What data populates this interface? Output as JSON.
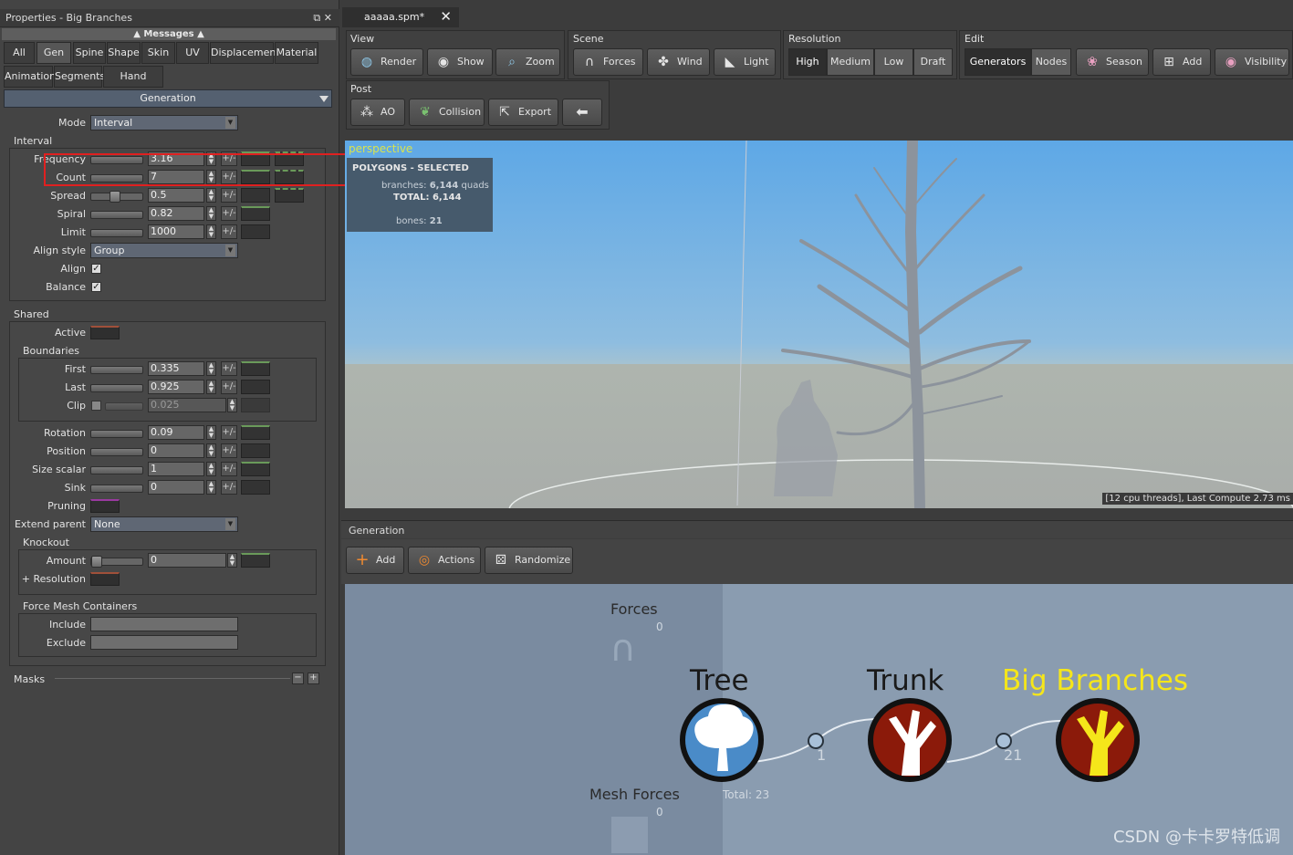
{
  "left_panel": {
    "title": "Properties - Big Branches",
    "messages": "Messages",
    "tabs_row1": [
      "All",
      "Gen",
      "Spine",
      "Shape",
      "Skin",
      "UV",
      "Displacement",
      "Material"
    ],
    "tabs_row2": [
      "Animation",
      "Segments",
      "Hand Drawn"
    ],
    "section": "Generation",
    "mode": {
      "label": "Mode",
      "value": "Interval"
    },
    "interval": {
      "title": "Interval",
      "rows": [
        {
          "label": "Frequency",
          "value": "3.16"
        },
        {
          "label": "Count",
          "value": "7"
        },
        {
          "label": "Spread",
          "value": "0.5"
        },
        {
          "label": "Spiral",
          "value": "0.82"
        },
        {
          "label": "Limit",
          "value": "1000"
        }
      ],
      "align_style": {
        "label": "Align style",
        "value": "Group"
      },
      "align": {
        "label": "Align"
      },
      "balance": {
        "label": "Balance"
      }
    },
    "shared": {
      "title": "Shared",
      "active": "Active",
      "boundaries_title": "Boundaries",
      "boundaries": [
        {
          "label": "First",
          "value": "0.335"
        },
        {
          "label": "Last",
          "value": "0.925"
        },
        {
          "label": "Clip",
          "value": "0.025"
        }
      ],
      "rows": [
        {
          "label": "Rotation",
          "value": "0.09"
        },
        {
          "label": "Position",
          "value": "0"
        },
        {
          "label": "Size scalar",
          "value": "1"
        },
        {
          "label": "Sink",
          "value": "0"
        }
      ],
      "pruning": "Pruning",
      "extend_parent": {
        "label": "Extend parent",
        "value": "None"
      },
      "knockout_title": "Knockout",
      "amount": {
        "label": "Amount",
        "value": "0"
      },
      "resolution": "+ Resolution",
      "fmc_title": "Force Mesh Containers",
      "include": "Include",
      "exclude": "Exclude"
    },
    "masks": "Masks",
    "pm": "+/-"
  },
  "doc_tab": {
    "name": "aaaaa.spm*"
  },
  "toolbar": {
    "view": {
      "label": "View",
      "buttons": [
        "Render",
        "Show",
        "Zoom"
      ]
    },
    "scene": {
      "label": "Scene",
      "buttons": [
        "Forces",
        "Wind",
        "Light"
      ]
    },
    "resolution": {
      "label": "Resolution",
      "options": [
        "High",
        "Medium",
        "Low",
        "Draft"
      ]
    },
    "edit": {
      "label": "Edit",
      "segs": [
        "Generators",
        "Nodes"
      ],
      "buttons": [
        "Season",
        "Add",
        "Visibility"
      ]
    },
    "post": {
      "label": "Post",
      "buttons": [
        "AO",
        "Collision",
        "Export"
      ]
    }
  },
  "viewport": {
    "label": "perspective",
    "poly_title": "POLYGONS - SELECTED",
    "branches_label": "branches:",
    "branches_value": "6,144",
    "branches_unit": "quads",
    "total_label": "TOTAL:",
    "total_value": "6,144",
    "bones_label": "bones:",
    "bones_value": "21",
    "compute": "[12 cpu threads], Last Compute 2.73 ms"
  },
  "generation": {
    "label": "Generation",
    "buttons": [
      "Add",
      "Actions",
      "Randomize"
    ],
    "forces": "Forces",
    "forces_count": "0",
    "mesh_forces": "Mesh Forces",
    "mesh_forces_count": "0",
    "nodes": [
      {
        "name": "Tree",
        "total": "Total: 23"
      },
      {
        "name": "Trunk",
        "count": "1"
      },
      {
        "name": "Big Branches",
        "count": "21"
      }
    ]
  },
  "watermark": "CSDN @卡卡罗特低调",
  "colors": {
    "selected_node": "#f5e61a",
    "tree_node": "#4a8bc8",
    "branch_node": "#8b1a0a"
  }
}
